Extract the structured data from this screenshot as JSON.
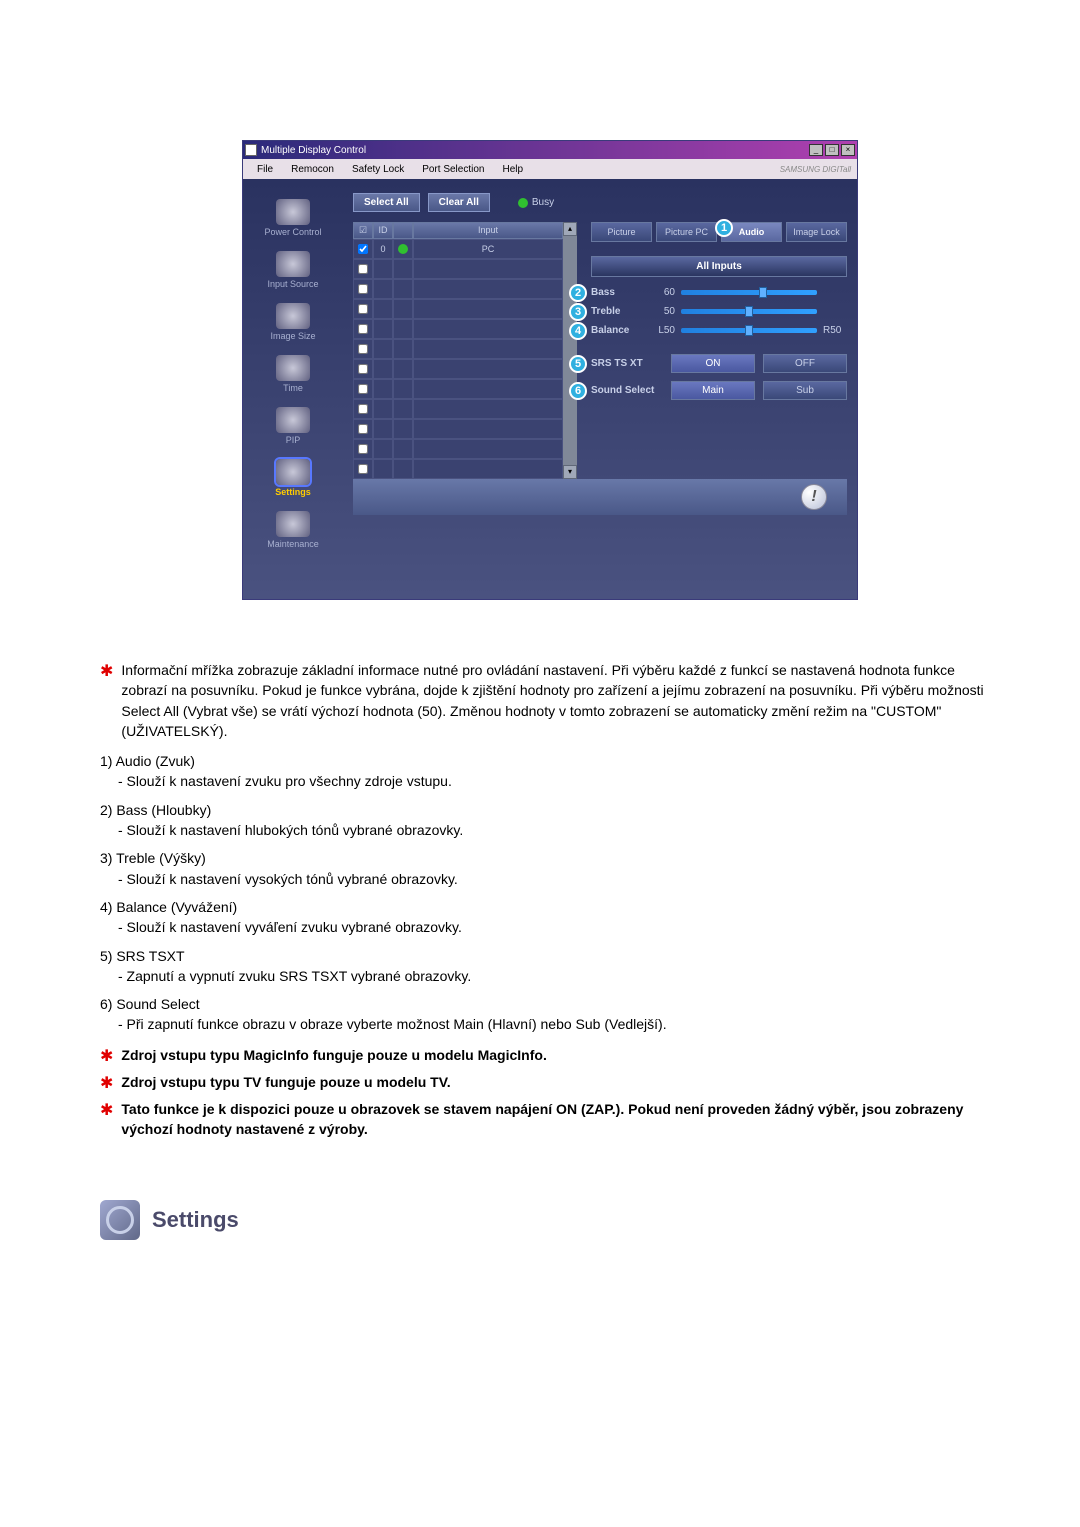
{
  "window": {
    "title": "Multiple Display Control",
    "menu": [
      "File",
      "Remocon",
      "Safety Lock",
      "Port Selection",
      "Help"
    ],
    "brand": "SAMSUNG DIGITall"
  },
  "sidebar": [
    {
      "label": "Power Control"
    },
    {
      "label": "Input Source"
    },
    {
      "label": "Image Size"
    },
    {
      "label": "Time"
    },
    {
      "label": "PIP"
    },
    {
      "label": "Settings"
    },
    {
      "label": "Maintenance"
    }
  ],
  "toolbar": {
    "select_all": "Select All",
    "clear_all": "Clear All",
    "busy": "Busy"
  },
  "grid": {
    "headers": {
      "id": "ID",
      "input": "Input"
    },
    "rows": [
      {
        "checked": true,
        "id": "0",
        "status": true,
        "input": "PC"
      },
      {
        "checked": false,
        "id": "",
        "status": false,
        "input": ""
      },
      {
        "checked": false,
        "id": "",
        "status": false,
        "input": ""
      },
      {
        "checked": false,
        "id": "",
        "status": false,
        "input": ""
      },
      {
        "checked": false,
        "id": "",
        "status": false,
        "input": ""
      },
      {
        "checked": false,
        "id": "",
        "status": false,
        "input": ""
      },
      {
        "checked": false,
        "id": "",
        "status": false,
        "input": ""
      },
      {
        "checked": false,
        "id": "",
        "status": false,
        "input": ""
      },
      {
        "checked": false,
        "id": "",
        "status": false,
        "input": ""
      },
      {
        "checked": false,
        "id": "",
        "status": false,
        "input": ""
      },
      {
        "checked": false,
        "id": "",
        "status": false,
        "input": ""
      },
      {
        "checked": false,
        "id": "",
        "status": false,
        "input": ""
      }
    ]
  },
  "tabs": [
    "Picture",
    "Picture PC",
    "Audio",
    "Image Lock"
  ],
  "all_inputs": "All Inputs",
  "audio": {
    "bass": {
      "label": "Bass",
      "value": "60",
      "pct": 60
    },
    "treble": {
      "label": "Treble",
      "value": "50",
      "pct": 50
    },
    "balance": {
      "label": "Balance",
      "value_l": "L50",
      "value_r": "R50",
      "pct": 50
    }
  },
  "srs": {
    "label": "SRS TS XT",
    "on": "ON",
    "off": "OFF"
  },
  "sound_select": {
    "label": "Sound Select",
    "main": "Main",
    "sub": "Sub"
  },
  "callouts": {
    "c1": "1",
    "c2": "2",
    "c3": "3",
    "c4": "4",
    "c5": "5",
    "c6": "6"
  },
  "text": {
    "intro": "Informační mřížka zobrazuje základní informace nutné pro ovládání nastavení. Při výběru každé z funkcí se nastavená hodnota funkce zobrazí na posuvníku. Pokud je funkce vybrána, dojde k zjištění hodnoty pro zařízení a jejímu zobrazení na posuvníku. Při výběru možnosti Select All (Vybrat vše) se vrátí výchozí hodnota (50). Změnou hodnoty v tomto zobrazení se automaticky změní režim na \"CUSTOM\" (UŽIVATELSKÝ).",
    "items": [
      {
        "title": "1) Audio (Zvuk)",
        "desc": "- Slouží k nastavení zvuku pro všechny zdroje vstupu."
      },
      {
        "title": "2) Bass (Hloubky)",
        "desc": "- Slouží k nastavení hlubokých tónů vybrané obrazovky."
      },
      {
        "title": "3) Treble (Výšky)",
        "desc": "- Slouží k nastavení vysokých tónů vybrané obrazovky."
      },
      {
        "title": "4) Balance (Vyvážení)",
        "desc": "- Slouží k nastavení vyváľení zvuku vybrané obrazovky."
      },
      {
        "title": "5) SRS TSXT",
        "desc": "- Zapnutí a vypnutí zvuku SRS TSXT vybrané obrazovky."
      },
      {
        "title": "6) Sound Select",
        "desc": "- Při zapnutí funkce obrazu v obraze vyberte možnost Main (Hlavní) nebo Sub (Vedlejší)."
      }
    ],
    "notes": [
      "Zdroj vstupu typu MagicInfo funguje pouze u modelu MagicInfo.",
      "Zdroj vstupu typu TV funguje pouze u modelu TV.",
      "Tato funkce je k dispozici pouze u obrazovek se stavem napájení ON (ZAP.). Pokud není proveden žádný výběr, jsou zobrazeny výchozí hodnoty nastavené z výroby."
    ]
  },
  "settings_heading": "Settings"
}
